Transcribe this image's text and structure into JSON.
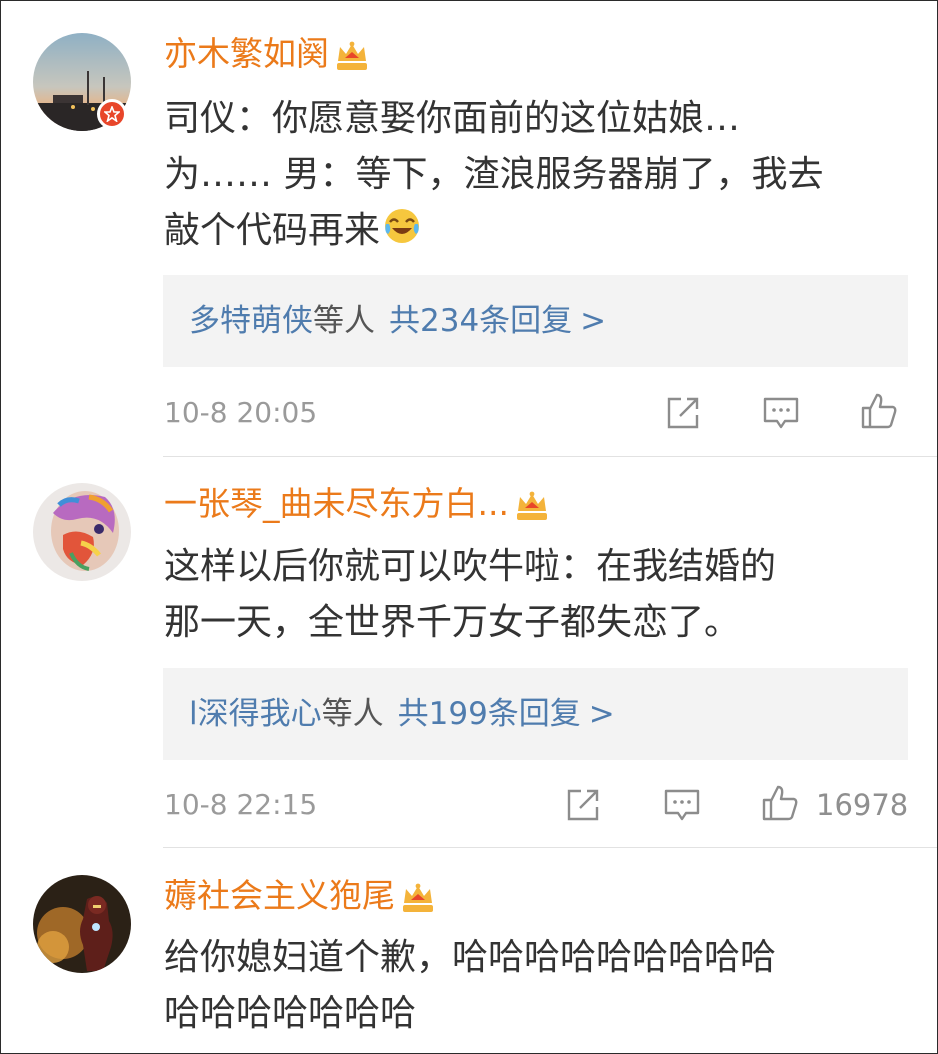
{
  "comments": [
    {
      "username": "亦木繁如阕",
      "text_lines": [
        "司仪：你愿意娶你面前的这位姑娘…",
        "为…… 男：等下，渣浪服务器崩了，我去",
        "敲个代码再来"
      ],
      "emoji": "laugh-cry-emoji",
      "reply_names": "多特萌侠",
      "reply_suffix": "等人",
      "reply_count": "共234条回复",
      "reply_arrow": ">",
      "time": "10-8 20:05",
      "likes": ""
    },
    {
      "username": "一张琴_曲未尽东方白...",
      "text_lines": [
        "这样以后你就可以吹牛啦：在我结婚的",
        "那一天，全世界千万女子都失恋了。"
      ],
      "reply_names": "l深得我心",
      "reply_suffix": "等人",
      "reply_count": "共199条回复",
      "reply_arrow": ">",
      "time": "10-8 22:15",
      "likes": "16978"
    },
    {
      "username": "薅社会主义狍尾",
      "text_lines": [
        "给你媳妇道个歉，哈哈哈哈哈哈哈哈哈",
        "哈哈哈哈哈哈哈"
      ]
    }
  ],
  "icons": {
    "vip_crown": "crown-icon",
    "verified": "verified-badge-icon",
    "share": "share-icon",
    "comment": "comment-icon",
    "like": "like-icon"
  },
  "colors": {
    "username": "#eb7a1a",
    "reply_link": "#4f7cae",
    "body_text": "#333333",
    "meta_text": "#9a9a9a",
    "reply_bg": "#f3f3f3",
    "crown": "#f4b33a",
    "verified_badge": "#e8462a"
  }
}
